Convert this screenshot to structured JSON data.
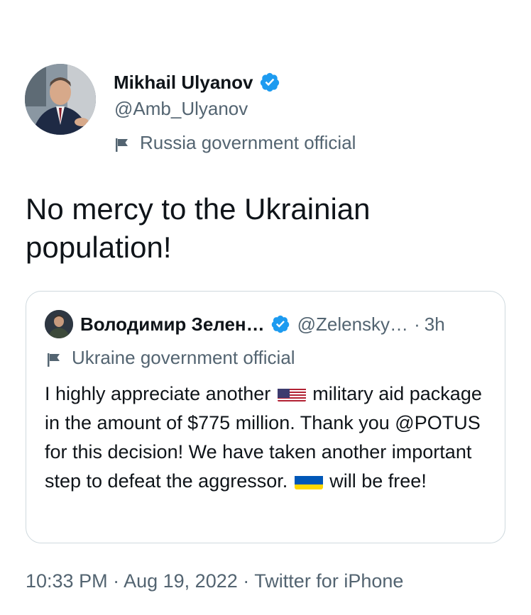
{
  "author": {
    "name": "Mikhail Ulyanov",
    "handle": "@Amb_Ulyanov",
    "label": "Russia government official"
  },
  "tweet": {
    "text": "No mercy to the Ukrainian population!"
  },
  "quoted": {
    "name": "Володимир Зелен…",
    "handle": "@Zelensky…",
    "separator": "·",
    "time": "3h",
    "label": "Ukraine government official",
    "text_part1": "I highly appreciate another",
    "flag_us": "🇺🇸",
    "text_part2": "military aid package in the amount of $775 million. Thank you @POTUS for this decision! We have taken another important step to defeat the aggressor.",
    "flag_ua": "🇺🇦",
    "text_part3": "will be free!"
  },
  "meta": {
    "time": "10:33 PM",
    "sep1": "·",
    "date": "Aug 19, 2022",
    "sep2": "·",
    "source": "Twitter for iPhone"
  },
  "colors": {
    "verified": "#1d9bf0",
    "secondary_text": "#536471",
    "primary_text": "#0f1419",
    "border": "#cfd9de"
  },
  "icons": [
    "verified-badge-icon",
    "government-flag-icon"
  ]
}
